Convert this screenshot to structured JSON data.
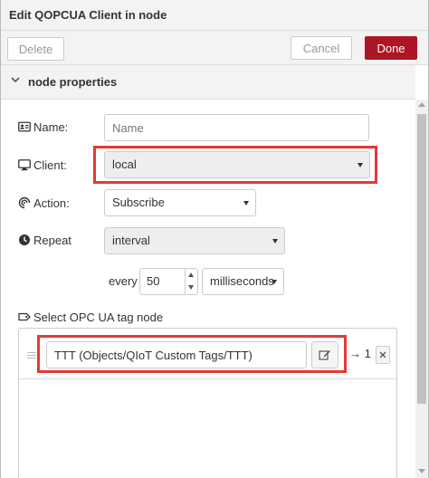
{
  "dialog": {
    "title": "Edit QOPCUA Client in node"
  },
  "toolbar": {
    "delete_label": "Delete",
    "cancel_label": "Cancel",
    "done_label": "Done"
  },
  "section": {
    "title": "node properties",
    "expanded_icon": "chevron-down-icon"
  },
  "form": {
    "name": {
      "label": "Name:",
      "icon": "id-card-icon",
      "value": "",
      "placeholder": "Name"
    },
    "client": {
      "label": "Client:",
      "icon": "monitor-icon",
      "selected": "local"
    },
    "action": {
      "label": "Action:",
      "icon": "signal-icon",
      "selected": "Subscribe"
    },
    "repeat": {
      "label": "Repeat",
      "icon": "clock-icon",
      "selected": "interval",
      "every_label": "every",
      "every_value": "50",
      "unit_selected": "milliseconds"
    },
    "tag_select": {
      "label": "Select OPC UA tag node",
      "icon": "tag-icon",
      "items": [
        {
          "value": "TTT (Objects/QIoT Custom Tags/TTT)",
          "output_label": "→ 1"
        }
      ]
    }
  },
  "colors": {
    "done_button": "#ad1625",
    "highlight": "#e53935"
  }
}
